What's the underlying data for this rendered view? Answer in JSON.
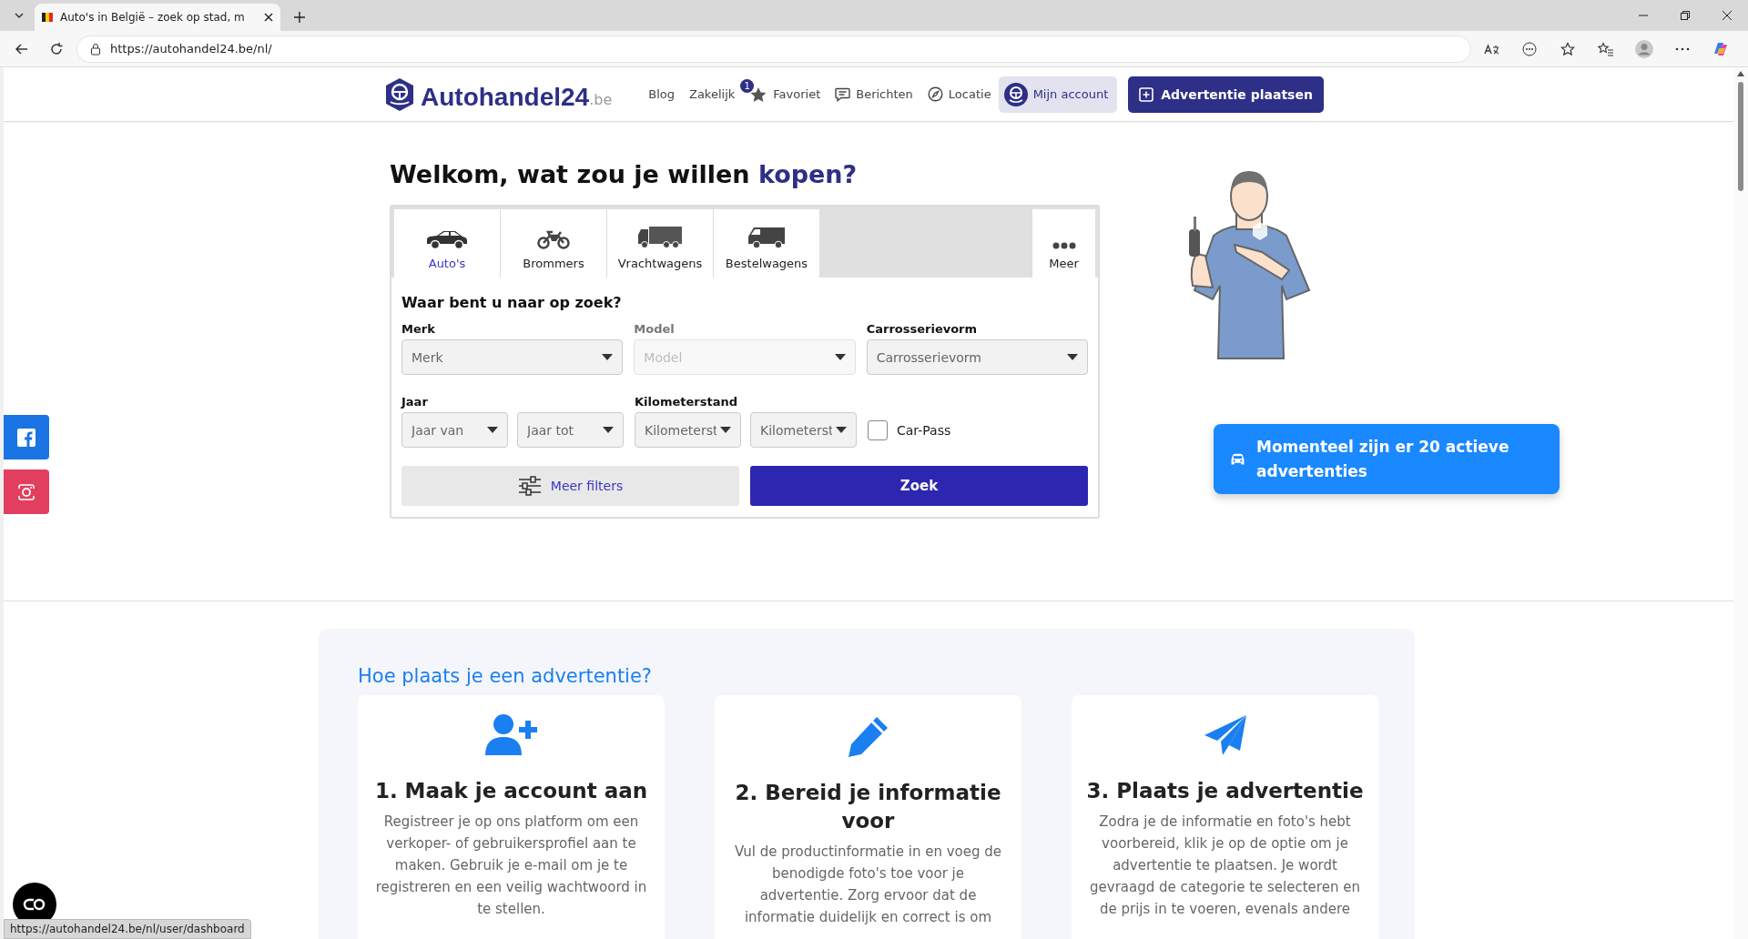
{
  "browser": {
    "tab_title": "Auto's in België – zoek op stad, m",
    "url": "https://autohandel24.be/nl/",
    "status_url": "https://autohandel24.be/nl/user/dashboard"
  },
  "header": {
    "logo": "Autohandel24",
    "logo_suffix": ".be",
    "nav": [
      {
        "label": "Blog",
        "kind": "text"
      },
      {
        "label": "Zakelijk",
        "kind": "text"
      },
      {
        "label": "Favoriet",
        "kind": "star",
        "badge": "1"
      },
      {
        "label": "Berichten",
        "kind": "chat"
      },
      {
        "label": "Locatie",
        "kind": "compass"
      }
    ],
    "account": "Mijn account",
    "cta": "Advertentie plaatsen"
  },
  "hero": {
    "heading": "Welkom, wat zou je willen",
    "heading_highlight": "kopen?"
  },
  "categories": [
    {
      "label": "Auto's",
      "kind": "car",
      "selected": true
    },
    {
      "label": "Brommers",
      "kind": "moped",
      "selected": false
    },
    {
      "label": "Vrachtwagens",
      "kind": "truck",
      "selected": false
    },
    {
      "label": "Bestelwagens",
      "kind": "van",
      "selected": false
    }
  ],
  "more_tab": "Meer",
  "form": {
    "title": "Waar bent u naar op zoek?",
    "row1": [
      {
        "label": "Merk",
        "placeholder": "Merk",
        "disabled": false
      },
      {
        "label": "Model",
        "placeholder": "Model",
        "disabled": true
      },
      {
        "label": "Carrosserievorm",
        "placeholder": "Carrosserievorm",
        "disabled": false
      }
    ],
    "row2": [
      {
        "label": "Jaar",
        "selects": [
          "Jaar van",
          "Jaar tot"
        ]
      },
      {
        "label": "Kilometerstand",
        "selects": [
          "Kilometerst",
          "Kilometerst"
        ]
      }
    ],
    "checkbox": {
      "label": "Car-Pass",
      "checked": false
    },
    "filters_button": "Meer filters",
    "search_button": "Zoek"
  },
  "banner": "Momenteel zijn er 20 actieve advertenties",
  "steps": {
    "title": "Hoe plaats je een advertentie?",
    "items": [
      {
        "kind": "user",
        "title": "1. Maak je account aan",
        "text": "Registreer je op ons platform om een verkoper- of gebruikersprofiel aan te maken. Gebruik je e-mail om je te registreren en een veilig wachtwoord in te stellen."
      },
      {
        "kind": "pencil",
        "title": "2. Bereid je informatie voor",
        "text": "Vul de productinformatie in en voeg de benodigde foto's toe voor je advertentie. Zorg ervoor dat de informatie duidelijk en correct is om"
      },
      {
        "kind": "plane",
        "title": "3. Plaats je advertentie",
        "text": "Zodra je de informatie en foto's hebt voorbereid, klik je op de optie om je advertentie te plaatsen. Je wordt gevraagd de categorie te selecteren en de prijs in te voeren, evenals andere"
      }
    ]
  }
}
